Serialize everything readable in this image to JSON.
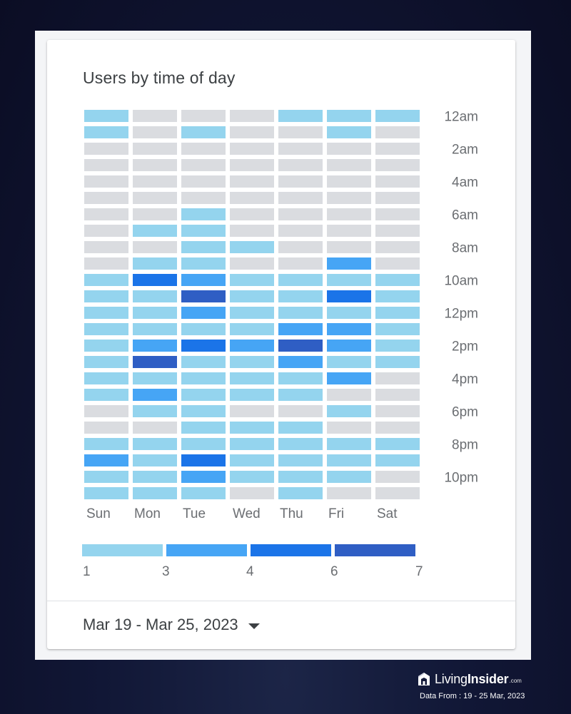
{
  "card": {
    "title": "Users by time of day",
    "date_range": "Mar 19 - Mar 25, 2023",
    "date_range_icon": "caret-down-icon"
  },
  "branding": {
    "logo_icon": "house-logo-icon",
    "name_light": "Living",
    "name_bold": "Insider",
    "name_suffix": ".com",
    "data_from": "Data From : 19 - 25 Mar, 2023"
  },
  "chart_data": {
    "type": "heatmap",
    "title": "Users by time of day",
    "x_categories": [
      "Sun",
      "Mon",
      "Tue",
      "Wed",
      "Thu",
      "Fri",
      "Sat"
    ],
    "y_categories": [
      "12am",
      "1am",
      "2am",
      "3am",
      "4am",
      "5am",
      "6am",
      "7am",
      "8am",
      "9am",
      "10am",
      "11am",
      "12pm",
      "1pm",
      "2pm",
      "3pm",
      "4pm",
      "5pm",
      "6pm",
      "7pm",
      "8pm",
      "9pm",
      "10pm",
      "11pm"
    ],
    "y_tick_labels": [
      "12am",
      "2am",
      "4am",
      "6am",
      "8am",
      "10am",
      "12pm",
      "2pm",
      "4pm",
      "6pm",
      "8pm",
      "10pm"
    ],
    "value_encoding": "legend bucket index: 0 = no users (gray), 1 = 1-3, 2 = 3-4, 3 = 4-6, 4 = 6-7",
    "legend": {
      "ticks": [
        "1",
        "3",
        "4",
        "6",
        "7"
      ],
      "colors": [
        "#94d4ee",
        "#46a5f5",
        "#1b74e8",
        "#2f5ec4"
      ],
      "empty_color": "#dadce0"
    },
    "values": [
      [
        1,
        0,
        0,
        0,
        1,
        1,
        1
      ],
      [
        1,
        0,
        1,
        0,
        0,
        1,
        0
      ],
      [
        0,
        0,
        0,
        0,
        0,
        0,
        0
      ],
      [
        0,
        0,
        0,
        0,
        0,
        0,
        0
      ],
      [
        0,
        0,
        0,
        0,
        0,
        0,
        0
      ],
      [
        0,
        0,
        0,
        0,
        0,
        0,
        0
      ],
      [
        0,
        0,
        1,
        0,
        0,
        0,
        0
      ],
      [
        0,
        1,
        1,
        0,
        0,
        0,
        0
      ],
      [
        0,
        0,
        1,
        1,
        0,
        0,
        0
      ],
      [
        0,
        1,
        1,
        0,
        0,
        2,
        0
      ],
      [
        1,
        3,
        2,
        1,
        1,
        1,
        1
      ],
      [
        1,
        1,
        4,
        1,
        1,
        3,
        1
      ],
      [
        1,
        1,
        2,
        1,
        1,
        1,
        1
      ],
      [
        1,
        1,
        1,
        1,
        2,
        2,
        1
      ],
      [
        1,
        2,
        3,
        2,
        4,
        2,
        1
      ],
      [
        1,
        4,
        1,
        1,
        2,
        1,
        1
      ],
      [
        1,
        1,
        1,
        1,
        1,
        2,
        0
      ],
      [
        1,
        2,
        1,
        1,
        1,
        0,
        0
      ],
      [
        0,
        1,
        1,
        0,
        0,
        1,
        0
      ],
      [
        0,
        0,
        1,
        1,
        1,
        0,
        0
      ],
      [
        1,
        1,
        1,
        1,
        1,
        1,
        1
      ],
      [
        2,
        1,
        3,
        1,
        1,
        1,
        1
      ],
      [
        1,
        1,
        2,
        1,
        1,
        1,
        0
      ],
      [
        1,
        1,
        1,
        0,
        1,
        0,
        0
      ]
    ]
  }
}
